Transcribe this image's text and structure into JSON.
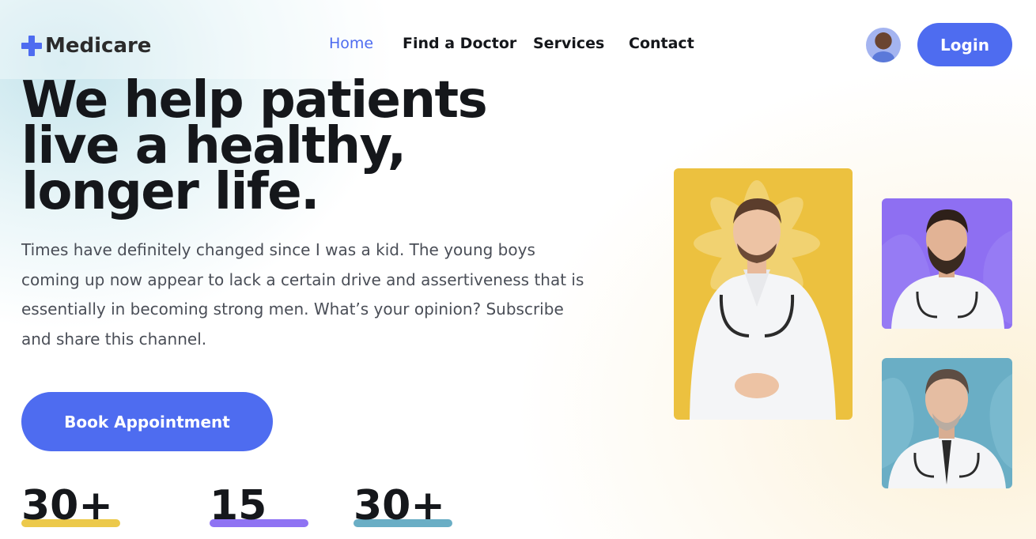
{
  "brand": {
    "name": "Medicare",
    "icon": "plus-icon",
    "accent": "#4e6cf0"
  },
  "nav": {
    "items": [
      {
        "label": "Home",
        "active": true
      },
      {
        "label": "Find a Doctor",
        "active": false
      },
      {
        "label": "Services",
        "active": false
      },
      {
        "label": "Contact",
        "active": false
      }
    ]
  },
  "header": {
    "login_label": "Login",
    "avatar": "user-avatar"
  },
  "hero": {
    "title_lines": [
      "We help patients",
      "live a healthy,",
      "longer life."
    ],
    "description": "Times have definitely changed since I was a kid. The young boys coming up now appear to lack a certain drive and assertiveness that is essentially in becoming strong men. What’s your opinion? Subscribe and share this channel.",
    "cta_label": "Book Appointment"
  },
  "stats": [
    {
      "value": "30+",
      "bar_color": "#ecc94b"
    },
    {
      "value": "15",
      "bar_color": "#8f73f3"
    },
    {
      "value": "30+",
      "bar_color": "#6aaec5"
    }
  ],
  "doctor_cards": [
    {
      "background": "#ecc13f",
      "image": "doctor-photo"
    },
    {
      "background": "#8e6ff2",
      "image": "doctor-photo"
    },
    {
      "background": "#6aaec5",
      "image": "doctor-photo"
    }
  ]
}
